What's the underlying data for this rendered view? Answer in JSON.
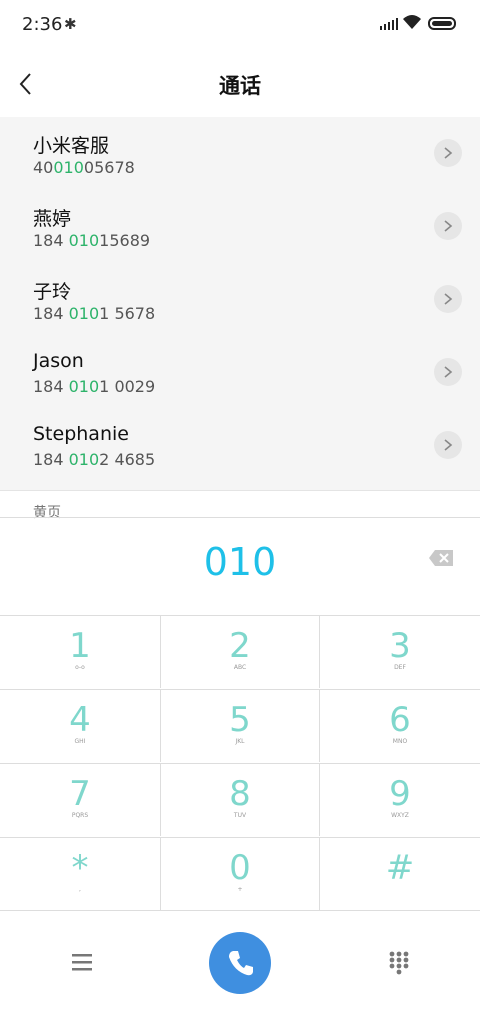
{
  "status": {
    "time": "2:36"
  },
  "header": {
    "title": "通话"
  },
  "contacts": [
    {
      "name": "小米客服",
      "num_pre": "40",
      "num_hl": "010",
      "num_post": "05678"
    },
    {
      "name": "燕婷",
      "num_pre": "184 ",
      "num_hl": "010",
      "num_post": "15689"
    },
    {
      "name": "子玲",
      "num_pre": "184 ",
      "num_hl": "010",
      "num_post": "1 5678"
    },
    {
      "name": "Jason",
      "num_pre": "184 ",
      "num_hl": "010",
      "num_post": "1 0029"
    },
    {
      "name": "Stephanie",
      "num_pre": "184 ",
      "num_hl": "010",
      "num_post": "2 4685"
    }
  ],
  "yellow_pages": {
    "label": "黄页"
  },
  "dial_display": {
    "value": "010"
  },
  "keypad": [
    {
      "digit": "1",
      "letters": "o-o"
    },
    {
      "digit": "2",
      "letters": "ABC"
    },
    {
      "digit": "3",
      "letters": "DEF"
    },
    {
      "digit": "4",
      "letters": "GHI"
    },
    {
      "digit": "5",
      "letters": "JKL"
    },
    {
      "digit": "6",
      "letters": "MNO"
    },
    {
      "digit": "7",
      "letters": "PQRS"
    },
    {
      "digit": "8",
      "letters": "TUV"
    },
    {
      "digit": "9",
      "letters": "WXYZ"
    },
    {
      "digit": "*",
      "letters": ","
    },
    {
      "digit": "0",
      "letters": "+"
    },
    {
      "digit": "#",
      "letters": ""
    }
  ],
  "colors": {
    "highlight": "#2db36a",
    "display": "#1ec0e8",
    "key_digit": "#7fd7cc",
    "call_button": "#3f8fe0"
  }
}
